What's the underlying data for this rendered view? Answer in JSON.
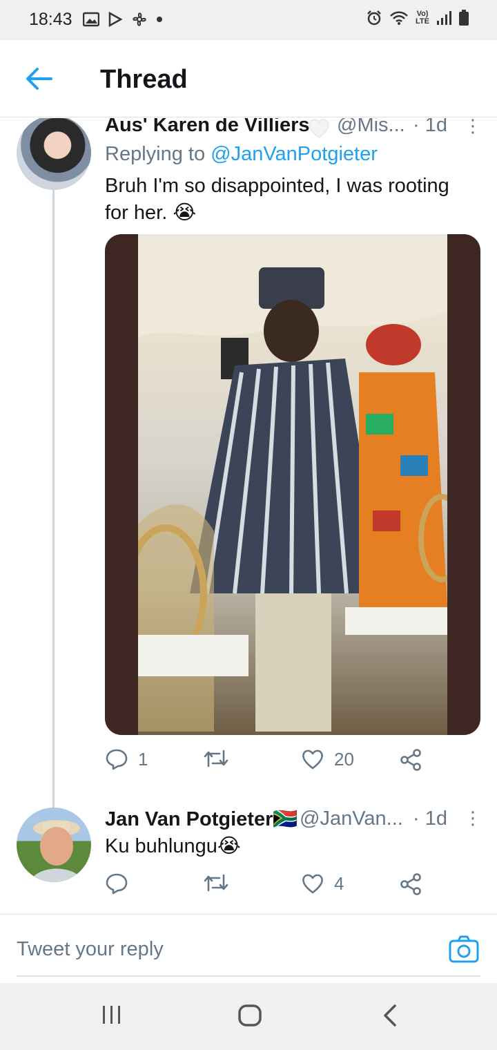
{
  "status_bar": {
    "time": "18:43",
    "left_icons": [
      "image-icon",
      "play-store-icon",
      "fan-icon",
      "dot-icon"
    ],
    "right_icons": [
      "alarm-icon",
      "wifi-icon",
      "volte-icon",
      "signal-icon",
      "battery-icon"
    ],
    "volte_label_top": "Vo)",
    "volte_label_bottom": "LTE"
  },
  "header": {
    "title": "Thread",
    "back_icon": "arrow-left-icon"
  },
  "tweets": [
    {
      "name": "Aus' Karen de Villiers",
      "handle": "@Mis...",
      "time": "· 1d",
      "more": "⋮",
      "replying_prefix": "Replying to ",
      "replying_to": "@JanVanPotgieter",
      "text": "Bruh I'm so disappointed, I was rooting for her. 😭",
      "has_media": true,
      "stats": {
        "replies": "1",
        "retweets": "",
        "likes": "20"
      }
    },
    {
      "name": "Jan Van Potgieter🇿🇦",
      "handle": "@JanVan...",
      "time": "· 1d",
      "more": "⋮",
      "text": "Ku buhlungu😭",
      "has_media": false,
      "stats": {
        "replies": "",
        "retweets": "",
        "likes": "4"
      }
    }
  ],
  "reply_box": {
    "placeholder": "Tweet your reply"
  },
  "colors": {
    "accent": "#1da1f2",
    "secondary_text": "#657786",
    "primary_text": "#14171a",
    "divider": "#dfe3e6"
  }
}
